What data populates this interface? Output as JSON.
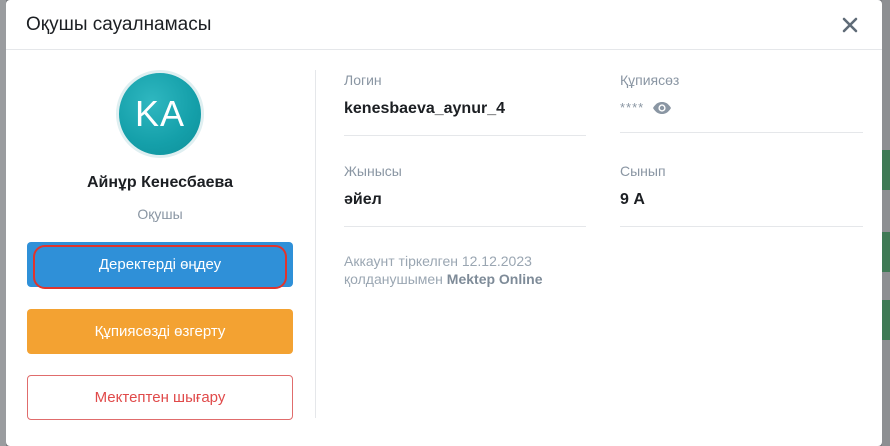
{
  "modal": {
    "title": "Оқушы сауалнамасы"
  },
  "profile": {
    "initials": "KA",
    "name": "Айнұр Кенесбаева",
    "role": "Оқушы"
  },
  "actions": {
    "edit_label": "Деректерді өңдеу",
    "change_password_label": "Құпиясөзді өзгерту",
    "expel_label": "Мектептен шығару"
  },
  "fields": {
    "login_label": "Логин",
    "login_value": "kenesbaeva_aynur_4",
    "password_label": "Құпиясөз",
    "password_value": "****",
    "gender_label": "Жынысы",
    "gender_value": "әйел",
    "class_label": "Сынып",
    "class_value": "9 А"
  },
  "account_note": {
    "line1": "Аккаунт тіркелген 12.12.2023",
    "line2_prefix": "қолданушымен ",
    "line2_brand": "Mektep Online"
  },
  "colors": {
    "primary": "#2f90d8",
    "warning": "#f3a232",
    "danger": "#e04a4a",
    "avatar": "#149fa9",
    "highlight": "#e0342d"
  },
  "icons": {
    "close": "close-icon",
    "eye": "eye-icon"
  }
}
